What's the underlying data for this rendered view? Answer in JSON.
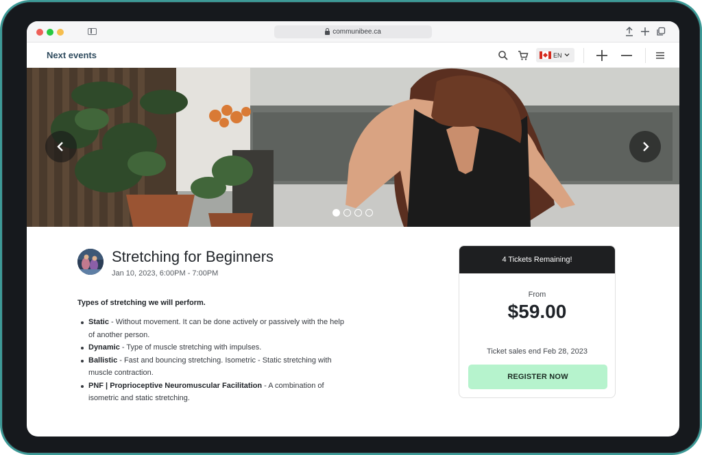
{
  "browser": {
    "url": "communibee.ca"
  },
  "site": {
    "nav_title": "Next events",
    "language_code": "EN",
    "colors": {
      "brand_text": "#2f4b5e",
      "ticket_header_bg": "#1e1f21",
      "register_button_bg": "#b6f3cd"
    }
  },
  "hero": {
    "slide_count": 4,
    "active_slide": 1
  },
  "event": {
    "title": "Stretching for Beginners",
    "date": "Jan 10, 2023, 6:00PM - 7:00PM",
    "description_heading": "Types of stretching we will perform.",
    "items": [
      {
        "term": "Static",
        "text": " - Without movement. It can be done actively or passively with the help of another person."
      },
      {
        "term": "Dynamic",
        "text": " - Type of muscle stretching with impulses."
      },
      {
        "term": "Ballistic",
        "text": " - Fast and bouncing stretching. Isometric - Static stretching with muscle contraction."
      },
      {
        "term": "PNF | Proprioceptive Neuromuscular Facilitation",
        "text": " - A combination of isometric and static stretching."
      }
    ]
  },
  "ticket": {
    "remaining": "4 Tickets Remaining!",
    "from_label": "From",
    "price": "$59.00",
    "sales_end": "Ticket sales end Feb 28, 2023",
    "register_label": "REGISTER NOW"
  }
}
